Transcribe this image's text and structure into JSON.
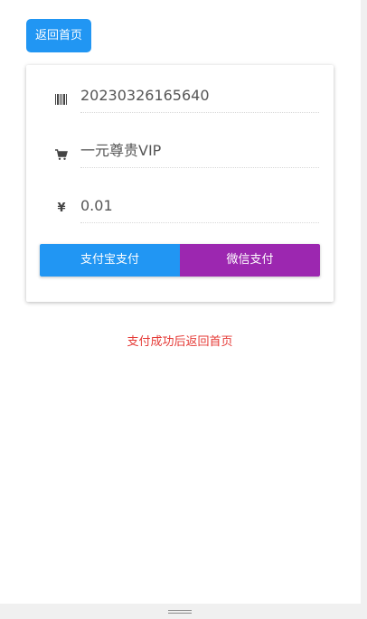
{
  "back_button": {
    "label": "返回首页"
  },
  "order": {
    "order_no": "20230326165640",
    "product": "一元尊贵VIP",
    "currency_symbol": "¥",
    "amount": "0.01"
  },
  "payment": {
    "alipay_label": "支付宝支付",
    "wechat_label": "微信支付"
  },
  "notice": "支付成功后返回首页",
  "colors": {
    "primary": "#2196f3",
    "wechat": "#9c27b0",
    "notice": "#e53935"
  },
  "icons": {
    "order_no": "barcode-icon",
    "product": "cart-icon",
    "amount": "yen-icon"
  }
}
